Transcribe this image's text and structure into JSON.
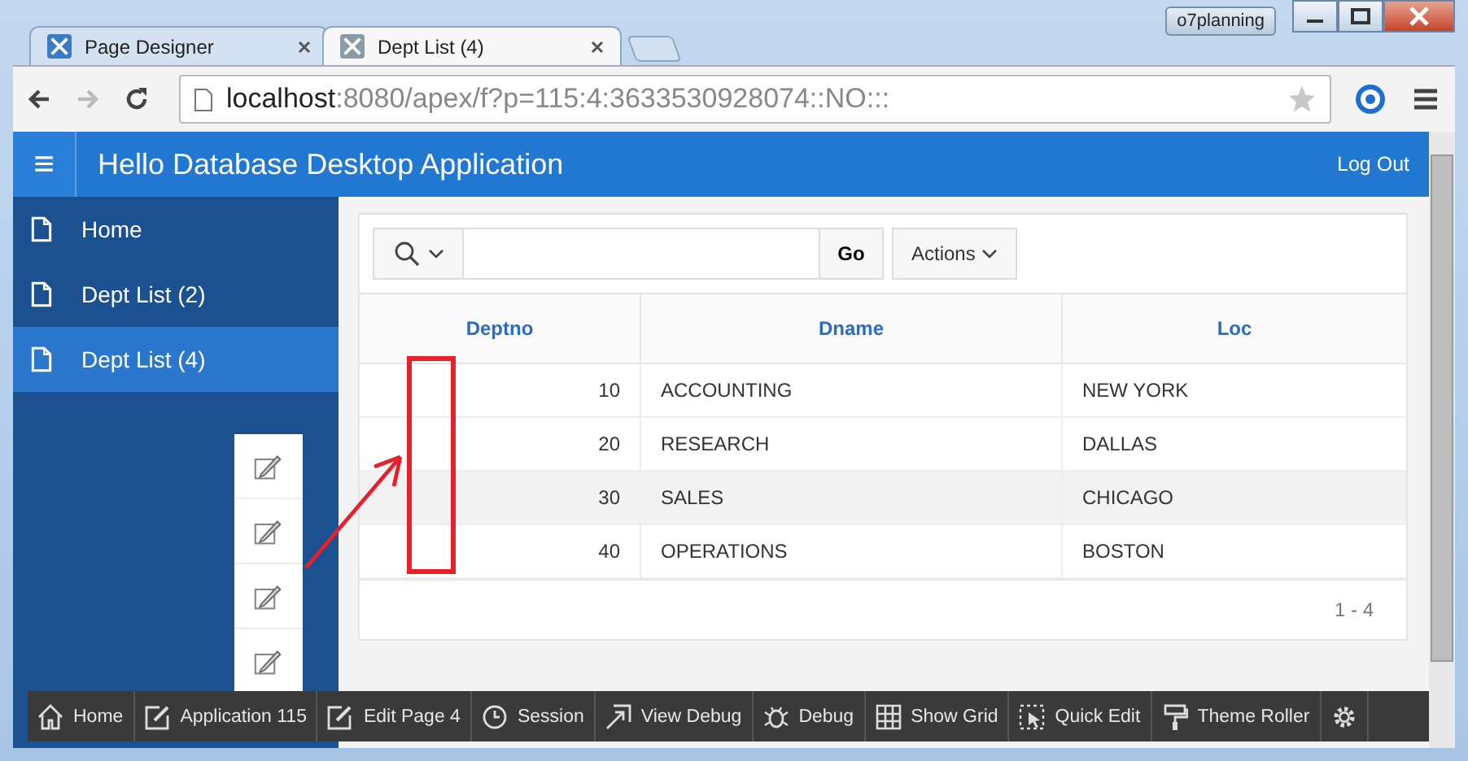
{
  "browser": {
    "user": "o7planning",
    "tabs": [
      {
        "title": "Page Designer",
        "selected": false
      },
      {
        "title": "Dept List (4)",
        "selected": true
      }
    ],
    "url_host": "localhost",
    "url_path": ":8080/apex/f?p=115:4:3633530928074::NO:::"
  },
  "header": {
    "menu_icon": "≡",
    "title": "Hello Database Desktop Application",
    "logout": "Log Out"
  },
  "sidebar": {
    "items": [
      {
        "label": "Home",
        "selected": false
      },
      {
        "label": "Dept List (2)",
        "selected": false
      },
      {
        "label": "Dept List (4)",
        "selected": true
      }
    ]
  },
  "report": {
    "go": "Go",
    "actions": "Actions",
    "columns": [
      "Deptno",
      "Dname",
      "Loc"
    ],
    "rows": [
      {
        "deptno": "10",
        "dname": "ACCOUNTING",
        "loc": "NEW YORK",
        "hovered": false
      },
      {
        "deptno": "20",
        "dname": "RESEARCH",
        "loc": "DALLAS",
        "hovered": false
      },
      {
        "deptno": "30",
        "dname": "SALES",
        "loc": "CHICAGO",
        "hovered": true
      },
      {
        "deptno": "40",
        "dname": "OPERATIONS",
        "loc": "BOSTON",
        "hovered": false
      }
    ],
    "pagination": "1 - 4"
  },
  "dev_toolbar": [
    {
      "kind": "home",
      "label": "Home"
    },
    {
      "kind": "edit",
      "label": "Application 115"
    },
    {
      "kind": "edit",
      "label": "Edit Page 4"
    },
    {
      "kind": "clock",
      "label": "Session"
    },
    {
      "kind": "view",
      "label": "View Debug"
    },
    {
      "kind": "bug",
      "label": "Debug"
    },
    {
      "kind": "grid",
      "label": "Show Grid"
    },
    {
      "kind": "select",
      "label": "Quick Edit"
    },
    {
      "kind": "roller",
      "label": "Theme Roller"
    },
    {
      "kind": "gear"
    }
  ]
}
